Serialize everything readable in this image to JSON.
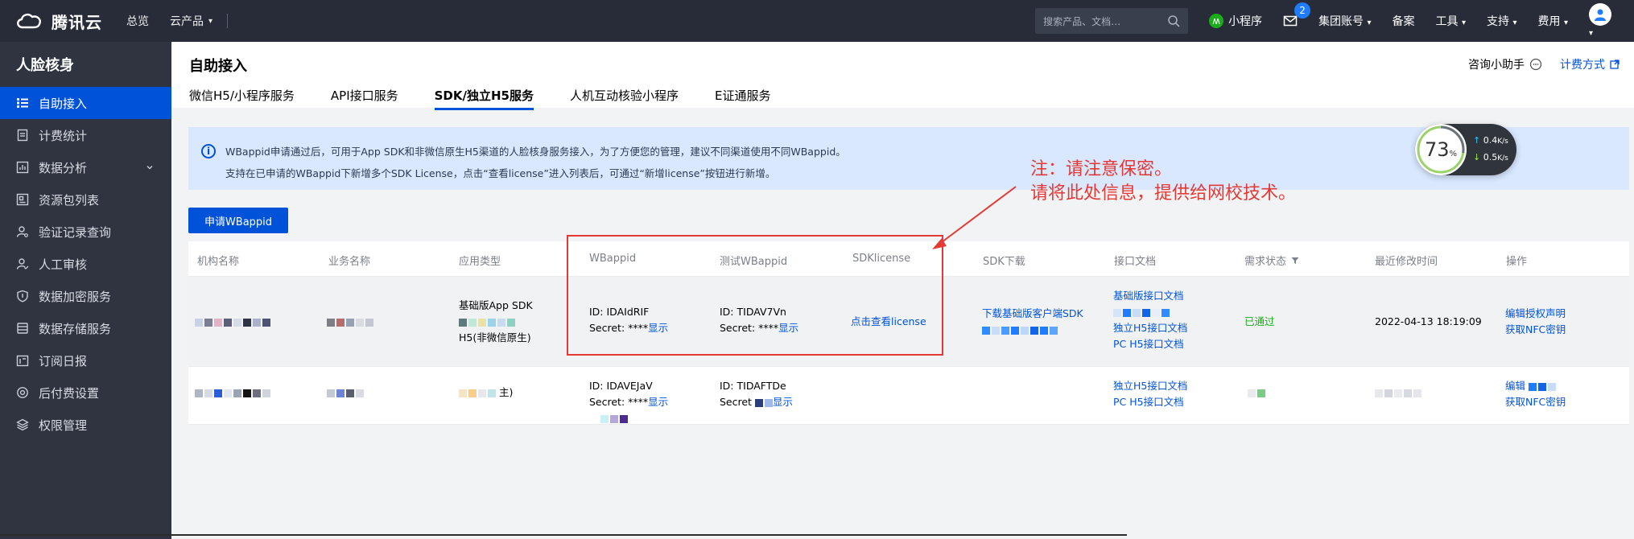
{
  "topbar": {
    "brand": "腾讯云",
    "nav": [
      "总览",
      "云产品"
    ],
    "search_placeholder": "搜索产品、文档…",
    "mini_program": "小程序",
    "mail_count": "2",
    "menus": [
      "集团账号",
      "备案",
      "工具",
      "支持",
      "费用"
    ]
  },
  "sidebar": {
    "title": "人脸核身",
    "items": [
      {
        "label": "自助接入",
        "icon": "bars-icon"
      },
      {
        "label": "计费统计",
        "icon": "receipt-icon"
      },
      {
        "label": "数据分析",
        "icon": "chart-icon"
      },
      {
        "label": "资源包列表",
        "icon": "package-icon"
      },
      {
        "label": "验证记录查询",
        "icon": "user-search-icon"
      },
      {
        "label": "人工审核",
        "icon": "user-check-icon"
      },
      {
        "label": "数据加密服务",
        "icon": "shield-icon"
      },
      {
        "label": "数据存储服务",
        "icon": "database-icon"
      },
      {
        "label": "订阅日报",
        "icon": "calendar-icon"
      },
      {
        "label": "后付费设置",
        "icon": "settings-icon"
      },
      {
        "label": "权限管理",
        "icon": "layers-icon"
      }
    ]
  },
  "header": {
    "title": "自助接入",
    "assistant": "咨询小助手",
    "billing": "计费方式",
    "tabs": [
      "微信H5/小程序服务",
      "API接口服务",
      "SDK/独立H5服务",
      "人机互动核验小程序",
      "E证通服务"
    ]
  },
  "notice": {
    "line1": "WBappid申请通过后，可用于App SDK和非微信原生H5渠道的人脸核身服务接入，为了方便您的管理，建议不同渠道使用不同WBappid。",
    "line2": "支持在已申请的WBappid下新增多个SDK License，点击“查看license”进入列表后，可通过“新增license”按钮进行新增。"
  },
  "apply_button": "申请WBappid",
  "table": {
    "columns": [
      "机构名称",
      "业务名称",
      "应用类型",
      "WBappid",
      "测试WBappid",
      "SDKlicense",
      "SDK下载",
      "接口文档",
      "需求状态",
      "最近修改时间",
      "操作"
    ],
    "rows": [
      {
        "app_type_line1": "基础版App SDK",
        "app_type_line2": "H5(非微信原生)",
        "wbappid_id": "ID: IDAIdRIF",
        "wbappid_secret": "Secret: ****",
        "wbappid_show": "显示",
        "test_id": "ID: TIDAV7Vn",
        "test_secret": "Secret: ****",
        "test_show": "显示",
        "license": "点击查看license",
        "sdk_download": "下载基础版客户端SDK",
        "docs": [
          "基础版接口文档",
          "独立H5接口文档",
          "PC H5接口文档"
        ],
        "status": "已通过",
        "modified": "2022-04-13 18:19:09",
        "actions": [
          "编辑授权声明",
          "获取NFC密钥"
        ]
      },
      {
        "app_type_line1": "主)",
        "wbappid_id": "ID: IDAVEJaV",
        "wbappid_secret": "Secret: ****",
        "wbappid_show": "显示",
        "test_id": "ID: TIDAFTDe",
        "test_secret": "Secret",
        "test_show": "显示",
        "docs": [
          "独立H5接口文档",
          "PC H5接口文档"
        ],
        "actions": [
          "编辑",
          "获取NFC密钥"
        ]
      }
    ]
  },
  "annotation": {
    "line1": "注：请注意保密。",
    "line2": "请将此处信息，提供给网校技术。"
  },
  "speed_widget": {
    "percent": "73",
    "percent_unit": "%",
    "upload": "0.4",
    "download": "0.5",
    "unit": "K/s"
  }
}
